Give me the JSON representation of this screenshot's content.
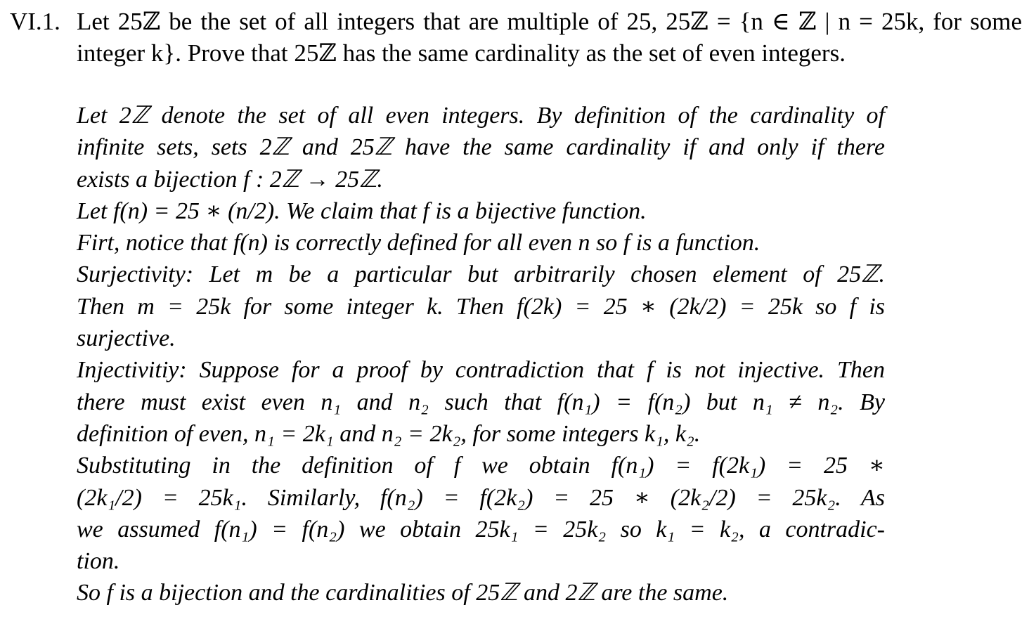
{
  "problem": {
    "number": "VI.1.",
    "statement": "Let 25ℤ be the set of all integers that are multiple of 25, 25ℤ = {n ∈ ℤ | n = 25k, for some integer k}. Prove that 25ℤ has the same cardinality as the set of even integers."
  },
  "proof": {
    "lines": [
      "Let 2ℤ denote the set of all even integers. By definition of the cardinality of",
      "infinite sets, sets 2ℤ and 25ℤ have the same cardinality if and only if there",
      "exists a bijection f : 2ℤ → 25ℤ.",
      "Let f(n) = 25 ∗ (n/2). We claim that f is a bijective function.",
      "Firt, notice that f(n) is correctly defined for all even n so f is a function.",
      "Surjectivity: Let m be a particular but arbitrarily chosen element of 25ℤ.",
      "Then m = 25k for some integer k. Then f(2k) = 25 ∗ (2k/2) = 25k so f is",
      "surjective.",
      "Injectivitiy: Suppose for a proof by contradiction that f is not injective. Then",
      "there must exist even n₁ and n₂ such that f(n₁) = f(n₂) but n₁ ≠ n₂. By",
      "definition of even, n₁ = 2k₁ and n₂ = 2k₂, for some integers k₁, k₂.",
      "Substituting in the definition of f we obtain f(n₁) = f(2k₁) = 25 ∗",
      "(2k₁/2) = 25k₁. Similarly, f(n₂) = f(2k₂) = 25 ∗ (2k₂/2) = 25k₂. As",
      "we assumed f(n₁) = f(n₂) we obtain 25k₁ = 25k₂ so k₁ = k₂, a contradic-",
      "tion.",
      "So f is a bijection and the cardinalities of 25ℤ and 2ℤ are the same."
    ]
  }
}
